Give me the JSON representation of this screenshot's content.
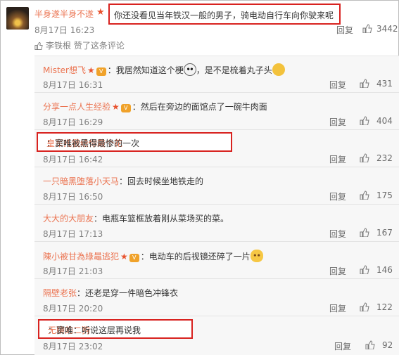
{
  "main_comment": {
    "username": "半身遂半身不遂",
    "text": "你还没看见当年铁汉一般的男子，骑电动自行车向你驶来呢",
    "time": "8月17日 16:23",
    "reply_label": "回复",
    "likes": "3442",
    "liked_by": "李铁根 赞了这条评论"
  },
  "replies": [
    {
      "name": "Mister想飞",
      "text": "：我居然知道这个梗",
      "text_after": "，是不是梳着丸子头",
      "time": "8月17日 16:31",
      "likes": "431",
      "emoji1": "panda-face",
      "emoji2": "pray-hands",
      "badges": true
    },
    {
      "name": "分享一点人生经验",
      "text": "：然后在旁边的面馆点了一碗牛肉面",
      "time": "8月17日 16:29",
      "likes": "404",
      "badges": true
    },
    {
      "name": "皇军托我给你戴个花",
      "text": "：窦唯被黑得最惨的一次",
      "time": "8月17日 16:42",
      "likes": "232",
      "highlight": true
    },
    {
      "name": "一只暗黑堕落小天马",
      "text": "：回去时候坐地铁走的",
      "time": "8月17日 16:50",
      "likes": "175"
    },
    {
      "name": "大大的大朋友",
      "text": "：电瓶车篮框放着刚从菜场买的菜。",
      "time": "8月17日 17:13",
      "likes": "167"
    },
    {
      "name": "陳小被甘為綠鼂逃犯",
      "text": "：电动车的后视镜还碎了一片",
      "time": "8月17日 21:03",
      "likes": "146",
      "badges": true,
      "emoji1": "cat-face"
    },
    {
      "name": "隔壁老张",
      "text": "：还老是穿一件暗色冲锋衣",
      "time": "8月17日 20:20",
      "likes": "122"
    },
    {
      "name": "无聊的二狗",
      "text": "：窦唯：听说这层再说我",
      "time": "8月17日 23:02",
      "likes": "92",
      "highlight": true
    }
  ],
  "labels": {
    "reply": "回复",
    "star": "★",
    "crown": "V"
  },
  "colors": {
    "name": "#eb7350",
    "highlight_border": "#d8221f",
    "meta": "#808080"
  }
}
